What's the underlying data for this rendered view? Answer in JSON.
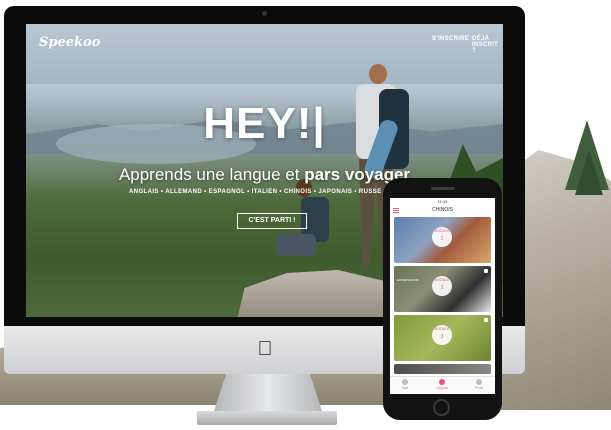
{
  "website": {
    "logo": "Speekoo",
    "nav": {
      "signup": "S'INSCRIRE",
      "login": "DÉJÀ INSCRIT ?"
    },
    "hero": {
      "title": "HEY!|",
      "subtitle_plain": "Apprends une langue et ",
      "subtitle_bold": "pars voyager",
      "languages": "ANGLAIS • ALLEMAND • ESPAGNOL • ITALIEN • CHINOIS • JAPONAIS • RUSSE • GREC",
      "cta": "C'EST PARTI !"
    }
  },
  "phone_app": {
    "status_time": "11:15",
    "screen_title": "CHINOIS",
    "cards": [
      {
        "badge": "MODULE",
        "number": "1",
        "locked": false,
        "caption": ""
      },
      {
        "badge": "MODULE",
        "number": "2",
        "locked": true,
        "caption": "EXPRESSIONS"
      },
      {
        "badge": "MODULE",
        "number": "3",
        "locked": true,
        "caption": ""
      }
    ],
    "tabs": [
      {
        "label": "Mes",
        "icon": "list-icon",
        "active": false
      },
      {
        "label": "Leçons",
        "icon": "location-pin-icon",
        "active": true
      },
      {
        "label": "Profil",
        "icon": "person-icon",
        "active": false
      }
    ]
  },
  "colors": {
    "accent": "#e0567a",
    "frame": "#0b0b0c",
    "chin": "#dcdcde"
  },
  "icons": {
    "brand": "apple-logo-icon"
  }
}
